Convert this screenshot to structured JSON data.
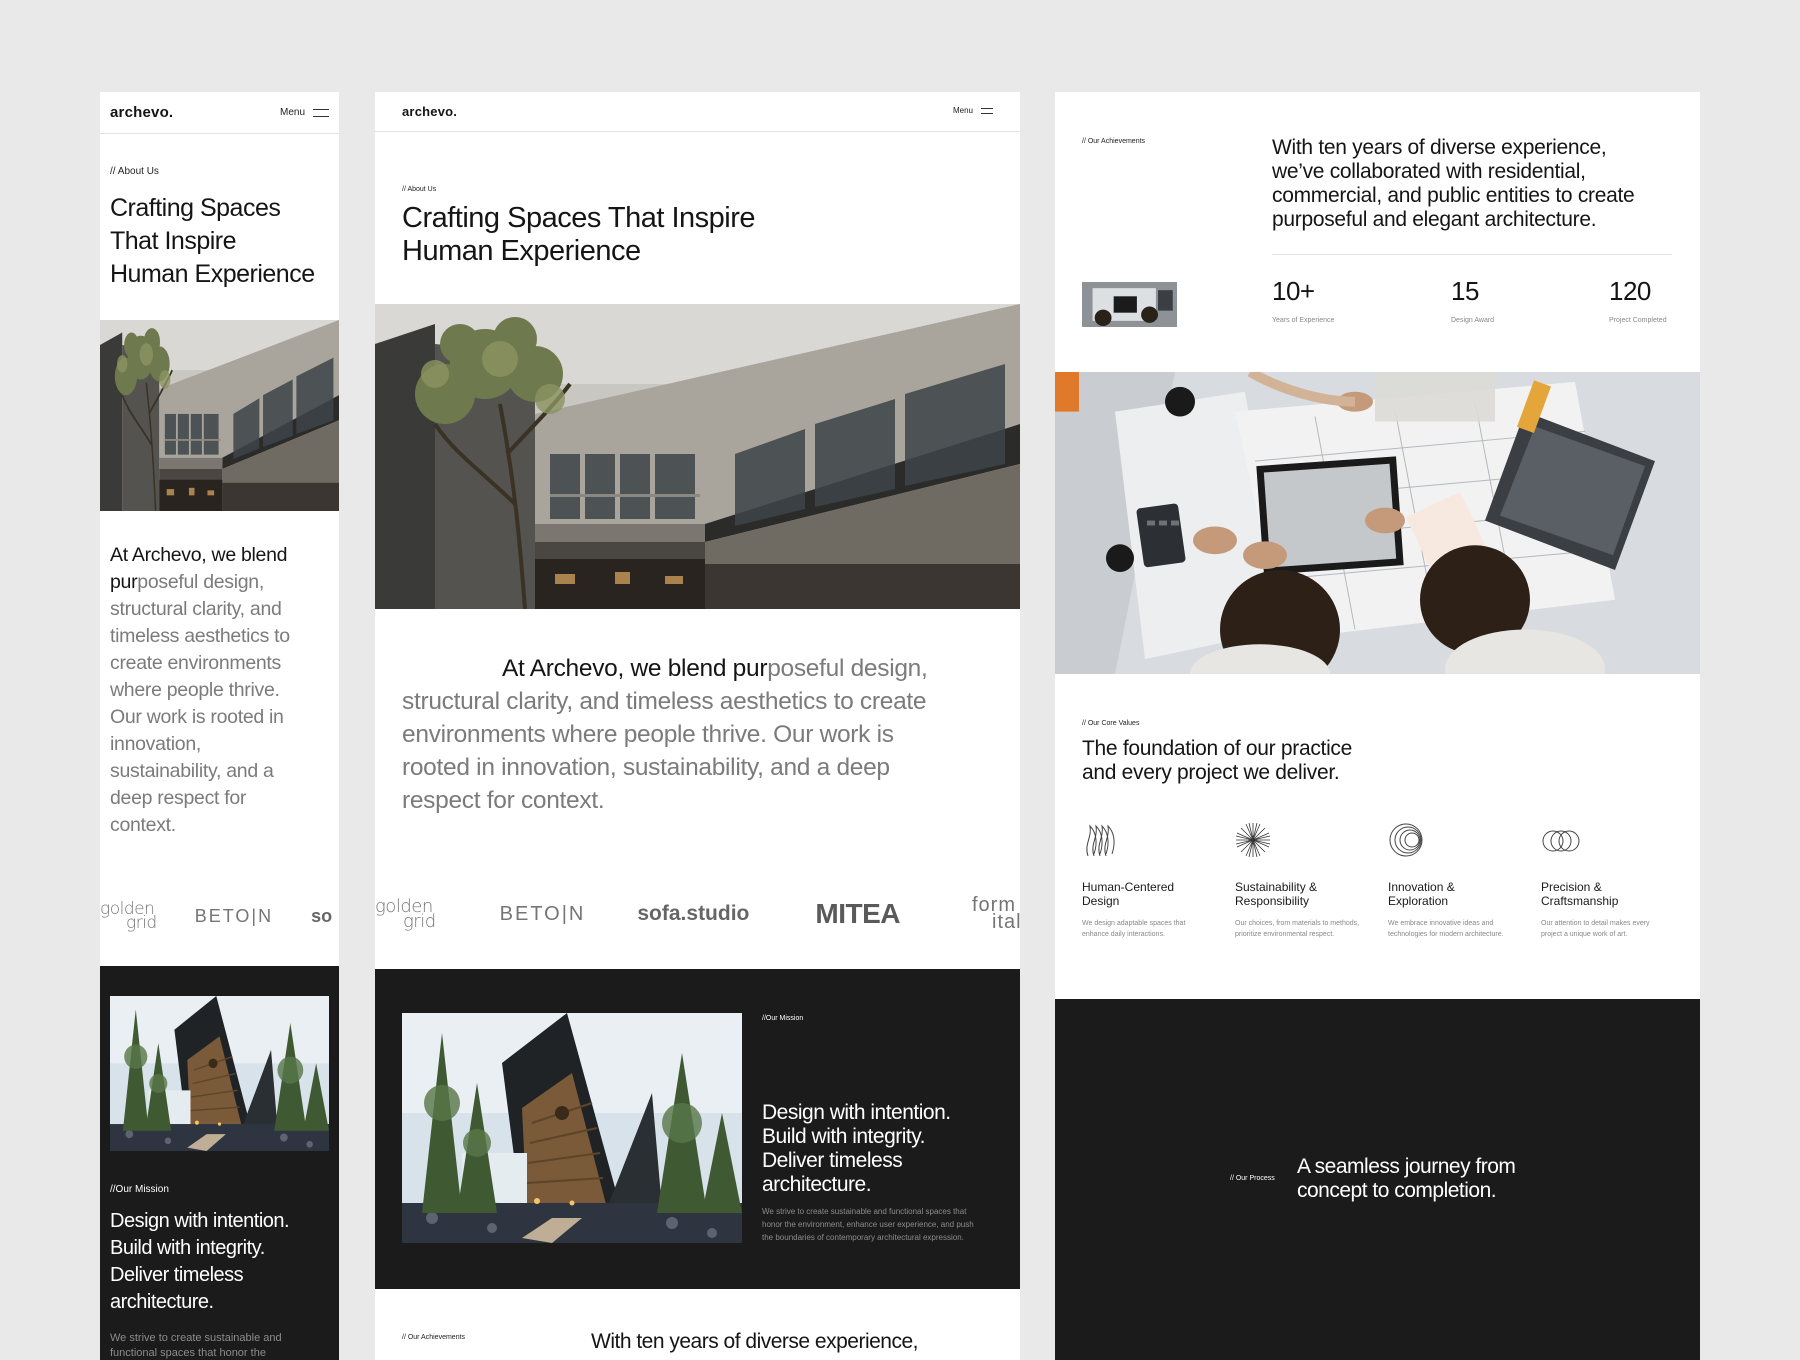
{
  "brand": "archevo.",
  "nav": {
    "menu_label": "Menu"
  },
  "about": {
    "tag": "// About Us",
    "title_m": [
      "Crafting Spaces",
      "That Inspire",
      "Human Experience"
    ],
    "title_t": [
      "Crafting Spaces That Inspire",
      "Human Experience"
    ]
  },
  "intro": {
    "mobile_lines": [
      {
        "dark": "At Archevo, we blend",
        "light": ""
      },
      {
        "dark": "pur",
        "light": "poseful design,"
      },
      {
        "dark": "",
        "light": "structural clarity, and"
      },
      {
        "dark": "",
        "light": "timeless aesthetics to"
      },
      {
        "dark": "",
        "light": "create environments"
      },
      {
        "dark": "",
        "light": "where people thrive."
      },
      {
        "dark": "",
        "light": "Our work is rooted in"
      },
      {
        "dark": "",
        "light": "innovation,"
      },
      {
        "dark": "",
        "light": "sustainability, and a"
      },
      {
        "dark": "",
        "light": "deep respect for"
      },
      {
        "dark": "",
        "light": "context."
      }
    ],
    "tablet_lines": [
      {
        "dark": "At Archevo, we blend pur",
        "light": "poseful design,"
      },
      {
        "dark": "",
        "light": "structural clarity, and timeless aesthetics to create"
      },
      {
        "dark": "",
        "light": "environments where people thrive. Our work is"
      },
      {
        "dark": "",
        "light": "rooted in innovation, sustainability, and a deep"
      },
      {
        "dark": "",
        "light": "respect for context."
      }
    ]
  },
  "partners": {
    "golden": [
      "golden",
      "grid"
    ],
    "beton": "BETO|N",
    "sofa": "sofa.studio",
    "sofa_cut": "so",
    "mitea": "MITEA",
    "form": [
      "form",
      "ital"
    ]
  },
  "mission": {
    "tag": "//Our Mission",
    "title_m": [
      "Design with intention.",
      "Build with integrity.",
      "Deliver timeless",
      "architecture."
    ],
    "title_t": [
      "Design with intention.",
      "Build with integrity.",
      "Deliver timeless",
      "architecture."
    ],
    "desc_m": [
      "We strive to create sustainable and",
      "functional spaces that honor the"
    ],
    "desc_t": [
      "We strive to create sustainable and functional spaces that",
      "honor the environment, enhance user experience, and push",
      "the boundaries of contemporary architectural expression."
    ]
  },
  "achievements": {
    "tag": "// Our Achievements",
    "text_lines": [
      "With ten years of diverse experience,",
      "we’ve collaborated with residential,",
      "commercial, and public entities to create",
      "purposeful and elegant architecture."
    ],
    "tablet_line": "With ten years of diverse experience,",
    "stats": [
      {
        "value": "10+",
        "label": "Years of Experience"
      },
      {
        "value": "15",
        "label": "Design Award"
      },
      {
        "value": "120",
        "label": "Project Completed"
      }
    ]
  },
  "values": {
    "tag": "// Our Core Values",
    "title_lines": [
      "The foundation of our practice",
      "and every project we deliver."
    ],
    "items": [
      {
        "icon": "waves-icon",
        "title": [
          "Human-Centered",
          "Design"
        ],
        "desc": [
          "We design adaptable spaces that",
          "enhance daily interactions."
        ]
      },
      {
        "icon": "starburst-icon",
        "title": [
          "Sustainability &",
          "Responsibility"
        ],
        "desc": [
          "Our choices, from materials to methods,",
          "prioritize environmental respect."
        ]
      },
      {
        "icon": "spiral-icon",
        "title": [
          "Innovation &",
          "Exploration"
        ],
        "desc": [
          "We embrace innovative ideas and",
          "technologies for modern architecture."
        ]
      },
      {
        "icon": "rings-icon",
        "title": [
          "Precision &",
          "Craftsmanship"
        ],
        "desc": [
          "Our attention to detail makes every",
          "project a unique work of art."
        ]
      }
    ]
  },
  "process": {
    "tag": "// Our Process",
    "title_lines": [
      "A seamless journey from",
      "concept to completion."
    ]
  },
  "colors": {
    "background": "#e9e9e9",
    "dark_section": "#1b1b1b",
    "text_dark": "#151515",
    "text_muted": "#7b7b7b"
  }
}
